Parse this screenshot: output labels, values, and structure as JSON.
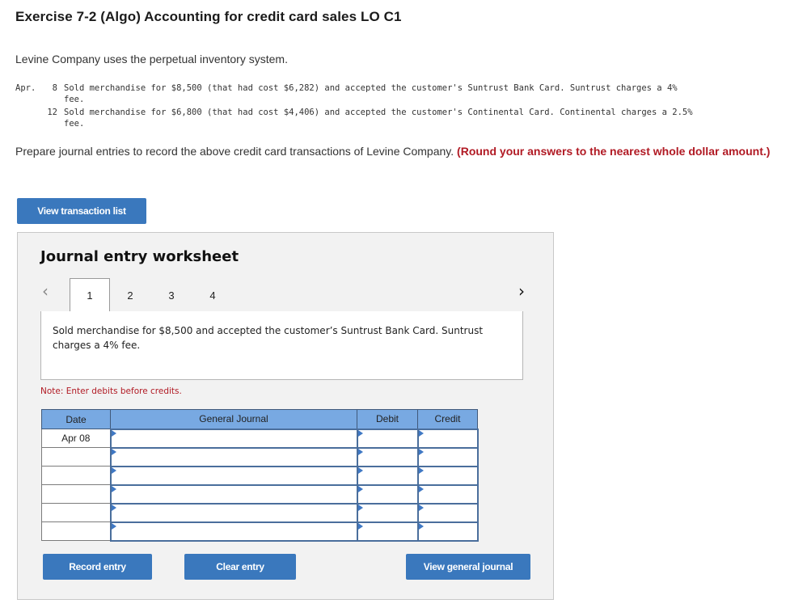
{
  "header": {
    "title": "Exercise 7-2 (Algo) Accounting for credit card sales LO C1",
    "intro": "Levine Company uses the perpetual inventory system."
  },
  "transactions": {
    "month": "Apr.",
    "items": [
      {
        "day": "8",
        "line1": "Sold merchandise for $8,500 (that had cost $6,282) and accepted the customer's Suntrust Bank Card. Suntrust charges a 4%",
        "line2": "fee."
      },
      {
        "day": "12",
        "line1": "Sold merchandise for $6,800 (that had cost $4,406) and accepted the customer's Continental Card. Continental charges a 2.5%",
        "line2": "fee."
      }
    ]
  },
  "instructions": {
    "text": "Prepare journal entries to record the above credit card transactions of Levine Company.",
    "emphasis": "(Round your answers to the nearest whole dollar amount.)"
  },
  "buttons": {
    "view_transaction_list": "View transaction list",
    "record_entry": "Record entry",
    "clear_entry": "Clear entry",
    "view_general_journal": "View general journal"
  },
  "worksheet": {
    "title": "Journal entry worksheet",
    "prev_icon": "chevron-left-icon",
    "next_icon": "chevron-right-icon",
    "tabs": [
      {
        "label": "1",
        "active": true
      },
      {
        "label": "2",
        "active": false
      },
      {
        "label": "3",
        "active": false
      },
      {
        "label": "4",
        "active": false
      }
    ],
    "description": "Sold merchandise for $8,500 and accepted the customer’s Suntrust Bank Card. Suntrust charges a 4% fee.",
    "note": "Note: Enter debits before credits.",
    "table": {
      "headers": {
        "date": "Date",
        "journal": "General Journal",
        "debit": "Debit",
        "credit": "Credit"
      },
      "rows": [
        {
          "date": "Apr 08",
          "account": "",
          "debit": "",
          "credit": ""
        },
        {
          "date": "",
          "account": "",
          "debit": "",
          "credit": ""
        },
        {
          "date": "",
          "account": "",
          "debit": "",
          "credit": ""
        },
        {
          "date": "",
          "account": "",
          "debit": "",
          "credit": ""
        },
        {
          "date": "",
          "account": "",
          "debit": "",
          "credit": ""
        },
        {
          "date": "",
          "account": "",
          "debit": "",
          "credit": ""
        }
      ]
    }
  },
  "colors": {
    "button_blue": "#3a78bd",
    "header_blue": "#78a9e2",
    "emphasis_red": "#b11a24"
  }
}
